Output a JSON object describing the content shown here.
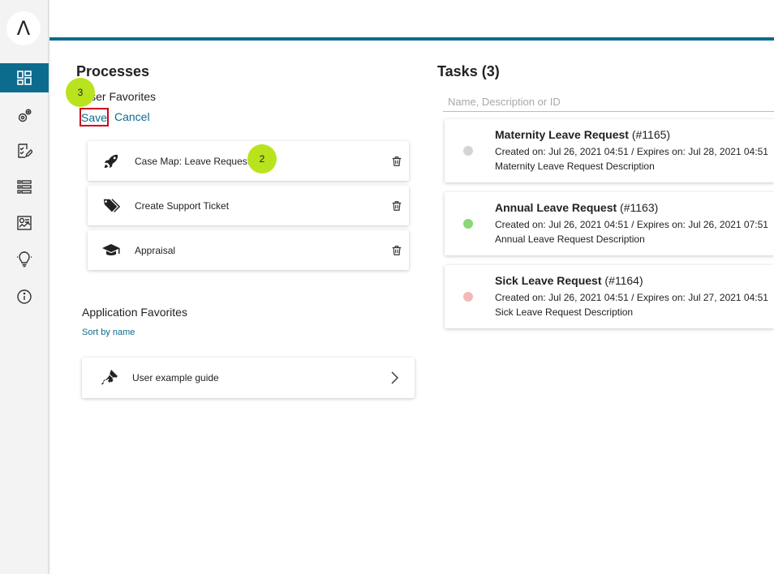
{
  "sidebar": {
    "logo_glyph": "Λ",
    "items": [
      {
        "name": "dashboard-icon",
        "active": true
      },
      {
        "name": "process-settings-icon",
        "active": false
      },
      {
        "name": "tasks-edit-icon",
        "active": false
      },
      {
        "name": "list-icon",
        "active": false
      },
      {
        "name": "statistics-icon",
        "active": false
      },
      {
        "name": "lightbulb-icon",
        "active": false
      },
      {
        "name": "info-icon",
        "active": false
      }
    ],
    "accent_color": "#0d6b8e"
  },
  "processes": {
    "title": "Processes",
    "user_favorites_label": "User Favorites",
    "save_label": "Save",
    "cancel_label": "Cancel",
    "favorites": [
      {
        "label": "Case Map: Leave Request",
        "icon": "rocket-icon"
      },
      {
        "label": "Create Support Ticket",
        "icon": "tags-icon"
      },
      {
        "label": "Appraisal",
        "icon": "graduation-cap-icon"
      }
    ],
    "application_favorites_label": "Application Favorites",
    "sort_label": "Sort by name",
    "app_favorites": [
      {
        "label": "User example guide",
        "icon": "ticket-icon"
      }
    ]
  },
  "markers": {
    "step_save": "3",
    "step_case_map": "2"
  },
  "tasks": {
    "title": "Tasks (3)",
    "search_placeholder": "Name, Description or ID",
    "items": [
      {
        "name": "Maternity Leave Request",
        "id": "(#1165)",
        "created_label": "Created on:",
        "created": "Jul 26, 2021 04:51",
        "expires_label": "/ Expires on:",
        "expires": "Jul 28, 2021 04:51",
        "description": "Maternity Leave Request Description",
        "status_color": "#d4d4d4"
      },
      {
        "name": "Annual Leave Request",
        "id": "(#1163)",
        "created_label": "Created on:",
        "created": "Jul 26, 2021 04:51",
        "expires_label": "/ Expires on:",
        "expires": "Jul 26, 2021 07:51",
        "description": "Annual Leave Request Description",
        "status_color": "#8bd67a"
      },
      {
        "name": "Sick Leave Request",
        "id": "(#1164)",
        "created_label": "Created on:",
        "created": "Jul 26, 2021 04:51",
        "expires_label": "/ Expires on:",
        "expires": "Jul 27, 2021 04:51",
        "description": "Sick Leave Request Description",
        "status_color": "#f5b8b8"
      }
    ]
  }
}
